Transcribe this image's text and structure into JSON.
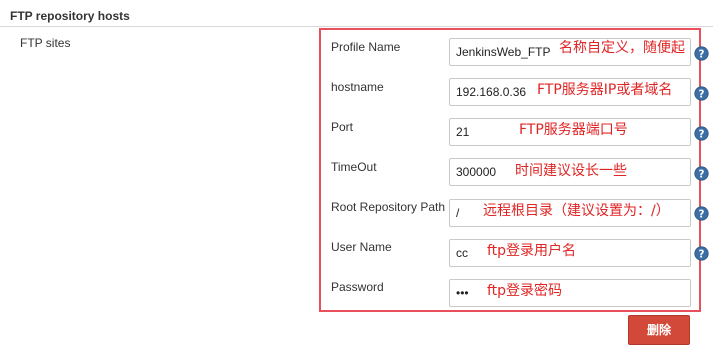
{
  "section": {
    "title": "FTP repository hosts",
    "ftp_sites_label": "FTP sites"
  },
  "fields": [
    {
      "label": "Profile Name",
      "value": "JenkinsWeb_FTP",
      "annotation": "名称自定义，随便起"
    },
    {
      "label": "hostname",
      "value": "192.168.0.36",
      "annotation": "FTP服务器IP或者域名"
    },
    {
      "label": "Port",
      "value": "21",
      "annotation": "FTP服务器端口号"
    },
    {
      "label": "TimeOut",
      "value": "300000",
      "annotation": "时间建议设长一些"
    },
    {
      "label": "Root Repository Path",
      "value": "/",
      "annotation": "远程根目录（建议设置为：/）"
    },
    {
      "label": "User Name",
      "value": "cc",
      "annotation": "ftp登录用户名"
    },
    {
      "label": "Password",
      "value": "•••",
      "annotation": "ftp登录密码"
    }
  ],
  "delete_button_label": "删除",
  "colors": {
    "annotation_red": "#e02424",
    "panel_border": "#e8505b",
    "help_icon": "#3b6ea5",
    "delete_button": "#d24939"
  },
  "icons": {
    "help": "help-icon"
  }
}
